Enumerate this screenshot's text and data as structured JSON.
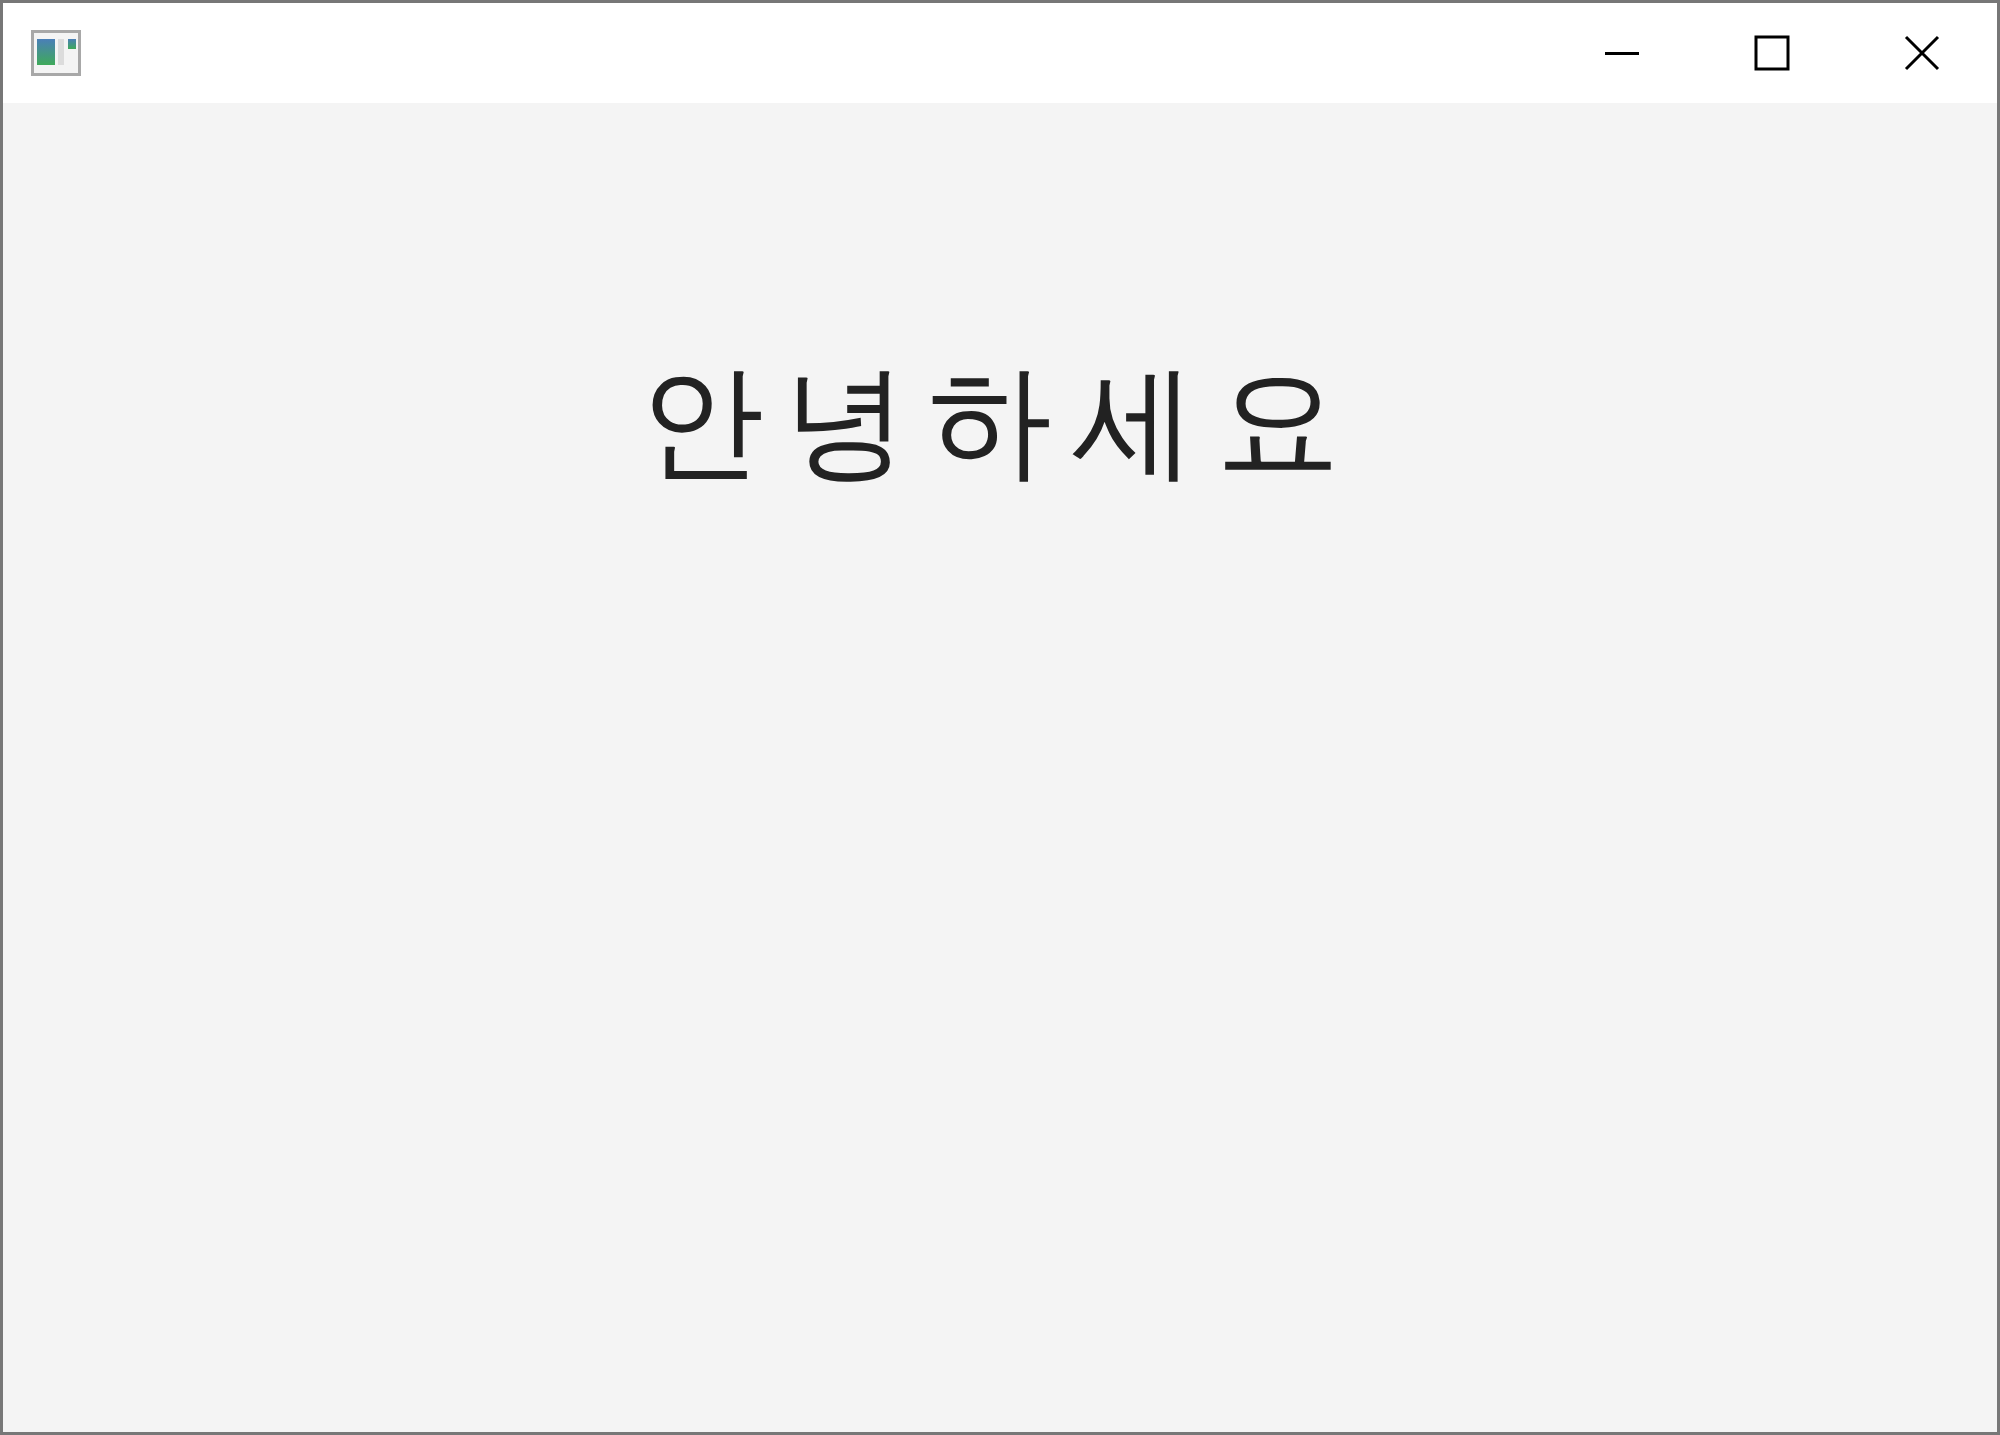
{
  "content": {
    "greeting": "안녕하세요"
  }
}
